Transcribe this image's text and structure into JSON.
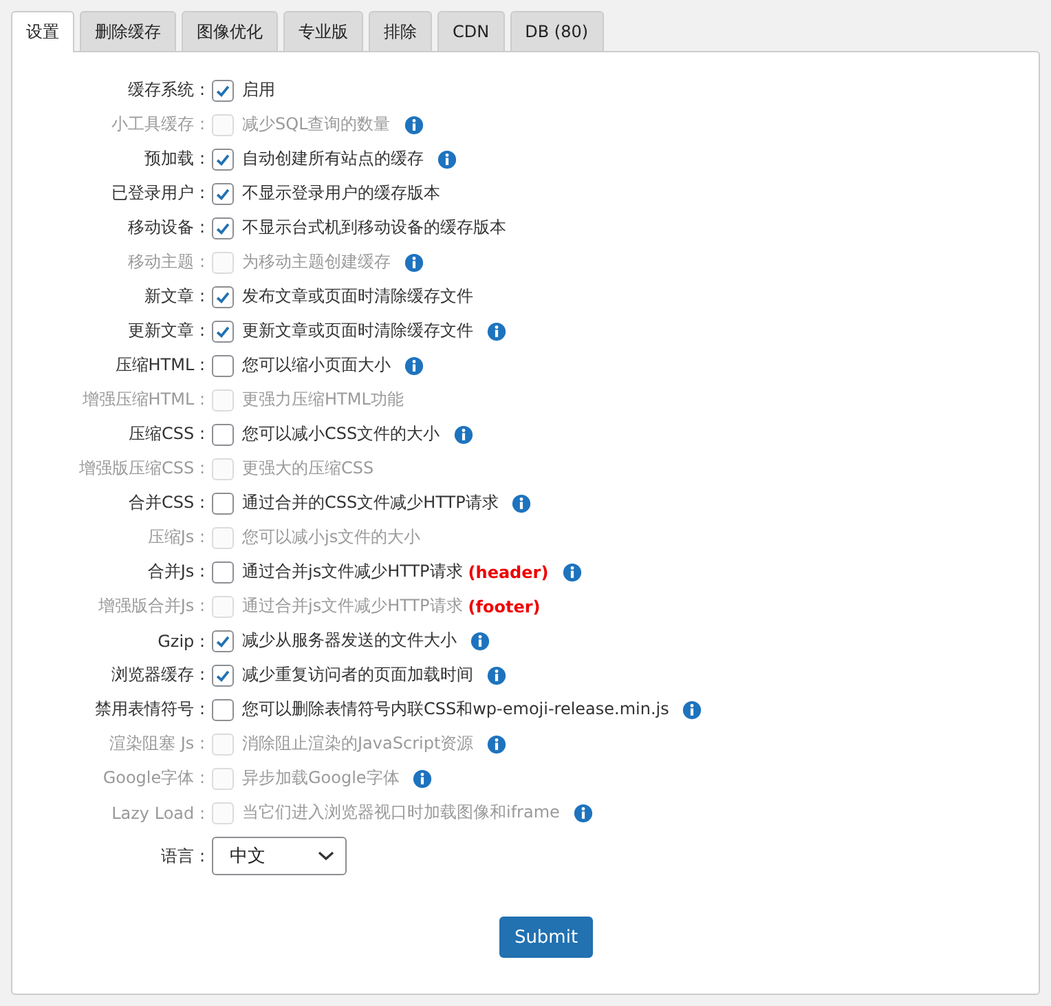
{
  "tabs": [
    {
      "label": "设置",
      "selected": true
    },
    {
      "label": "删除缓存",
      "selected": false
    },
    {
      "label": "图像优化",
      "selected": false
    },
    {
      "label": "专业版",
      "selected": false
    },
    {
      "label": "排除",
      "selected": false
    },
    {
      "label": "CDN",
      "selected": false
    },
    {
      "label": "DB (80)",
      "selected": false
    }
  ],
  "settings": [
    {
      "label": "缓存系统 :",
      "checked": true,
      "disabled": false,
      "description": "启用",
      "info": false
    },
    {
      "label": "小工具缓存 :",
      "checked": false,
      "disabled": true,
      "description": "减少SQL查询的数量",
      "info": true
    },
    {
      "label": "预加载 :",
      "checked": true,
      "disabled": false,
      "description": "自动创建所有站点的缓存",
      "info": true
    },
    {
      "label": "已登录用户 :",
      "checked": true,
      "disabled": false,
      "description": "不显示登录用户的缓存版本",
      "info": false
    },
    {
      "label": "移动设备 :",
      "checked": true,
      "disabled": false,
      "description": "不显示台式机到移动设备的缓存版本",
      "info": false
    },
    {
      "label": "移动主题 :",
      "checked": false,
      "disabled": true,
      "description": "为移动主题创建缓存",
      "info": true
    },
    {
      "label": "新文章 :",
      "checked": true,
      "disabled": false,
      "description": "发布文章或页面时清除缓存文件",
      "info": false
    },
    {
      "label": "更新文章 :",
      "checked": true,
      "disabled": false,
      "description": "更新文章或页面时清除缓存文件",
      "info": true
    },
    {
      "label": "压缩HTML :",
      "checked": false,
      "disabled": false,
      "description": "您可以缩小页面大小",
      "info": true
    },
    {
      "label": "增强压缩HTML :",
      "checked": false,
      "disabled": true,
      "description": "更强力压缩HTML功能",
      "info": false
    },
    {
      "label": "压缩CSS :",
      "checked": false,
      "disabled": false,
      "description": "您可以减小CSS文件的大小",
      "info": true
    },
    {
      "label": "增强版压缩CSS :",
      "checked": false,
      "disabled": true,
      "description": "更强大的压缩CSS",
      "info": false
    },
    {
      "label": "合并CSS :",
      "checked": false,
      "disabled": false,
      "description": "通过合并的CSS文件减少HTTP请求",
      "info": true
    },
    {
      "label": "压缩Js :",
      "checked": false,
      "disabled": true,
      "description": "您可以减小js文件的大小",
      "info": false
    },
    {
      "label": "合并Js :",
      "checked": false,
      "disabled": false,
      "description": "通过合并js文件减少HTTP请求",
      "note": "(header)",
      "info": true
    },
    {
      "label": "增强版合并Js :",
      "checked": false,
      "disabled": true,
      "description": "通过合并js文件减少HTTP请求",
      "note": "(footer)",
      "info": false
    },
    {
      "label": "Gzip :",
      "checked": true,
      "disabled": false,
      "description": "减少从服务器发送的文件大小",
      "info": true
    },
    {
      "label": "浏览器缓存 :",
      "checked": true,
      "disabled": false,
      "description": "减少重复访问者的页面加载时间",
      "info": true
    },
    {
      "label": "禁用表情符号 :",
      "checked": false,
      "disabled": false,
      "description": "您可以删除表情符号内联CSS和wp-emoji-release.min.js",
      "info": true
    },
    {
      "label": "渲染阻塞 Js :",
      "checked": false,
      "disabled": true,
      "description": "消除阻止渲染的JavaScript资源",
      "info": true
    },
    {
      "label": "Google字体 :",
      "checked": false,
      "disabled": true,
      "description": "异步加载Google字体",
      "info": true
    },
    {
      "label": "Lazy Load :",
      "checked": false,
      "disabled": true,
      "description": "当它们进入浏览器视口时加载图像和iframe",
      "info": true
    }
  ],
  "language": {
    "label": "语言 :",
    "value": "中文"
  },
  "submit": "Submit"
}
